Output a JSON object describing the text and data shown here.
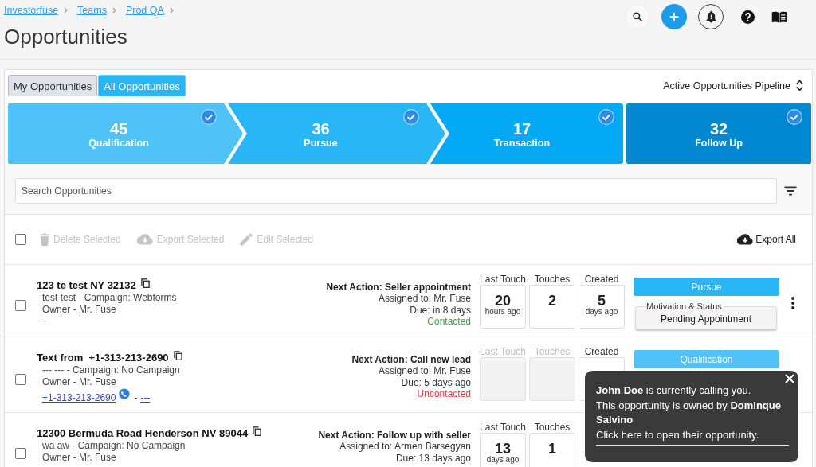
{
  "breadcrumbs": [
    {
      "label": "Investorfuse"
    },
    {
      "label": "Teams"
    },
    {
      "label": "Prod QA"
    }
  ],
  "page_title": "Opportunities",
  "tabs": [
    {
      "label": "My Opportunities",
      "selected": false
    },
    {
      "label": "All Opportunities",
      "selected": true
    }
  ],
  "pipeline_selector": "Active Opportunities Pipeline",
  "stages": [
    {
      "count": "45",
      "label": "Qualification",
      "checked": true,
      "color": "#4fc3f7"
    },
    {
      "count": "36",
      "label": "Pursue",
      "checked": true,
      "color": "#29b6f6"
    },
    {
      "count": "17",
      "label": "Transaction",
      "checked": true,
      "color": "#03a9f4"
    },
    {
      "count": "32",
      "label": "Follow Up",
      "checked": true,
      "color": "#0288d1"
    }
  ],
  "search": {
    "placeholder": "Search Opportunities"
  },
  "bulk_actions": {
    "select_all_checked": false,
    "actions": [
      {
        "kind": "delete",
        "label": "Delete Selected",
        "disabled": true
      },
      {
        "kind": "export",
        "label": "Export Selected",
        "disabled": true
      },
      {
        "kind": "edit",
        "label": "Edit Selected",
        "disabled": true
      }
    ],
    "export_all": "Export All"
  },
  "opportunities": [
    {
      "checked": false,
      "title": "123 te test NY 32132",
      "lines": [
        "test test - Campaign: Webforms",
        "Owner - Mr. Fuse",
        "-"
      ],
      "next_action": "Next Action: Seller appointment",
      "assigned": "Assigned to: Mr. Fuse",
      "due": "Due: in 8 days",
      "contact_status": {
        "label": "Contacted",
        "contacted": true
      },
      "stats": [
        {
          "label": "Last Touch",
          "value": "20",
          "unit": "hours ago",
          "empty": false
        },
        {
          "label": "Touches",
          "value": "2",
          "empty": false
        },
        {
          "label": "Created",
          "value": "5",
          "unit": "days ago",
          "empty": false
        }
      ],
      "stage": {
        "label": "Pursue",
        "color": "#29b6f6"
      },
      "motivation": {
        "legend": "Motivation & Status",
        "value": "Pending Appointment"
      },
      "menu_button": true
    },
    {
      "checked": false,
      "title": "Text from  +1-313-213-2690",
      "lines": [
        "--- --- - Campaign: No Campaign",
        "Owner - Mr. Fuse"
      ],
      "phone": {
        "number": "+1-313-213-2690",
        "separator": "-",
        "name": "---"
      },
      "next_action": "Next Action: Call new lead",
      "assigned": "Assigned to: Mr. Fuse",
      "due": "Due: 5 days ago",
      "contact_status": {
        "label": "Uncontacted",
        "contacted": false
      },
      "stats": [
        {
          "label": "Last Touch",
          "empty": true
        },
        {
          "label": "Touches",
          "empty": true
        },
        {
          "label": "Created",
          "empty": false
        }
      ],
      "stage": {
        "label": "Qualification",
        "color": "#4fc3f7"
      },
      "menu_button": false
    },
    {
      "checked": false,
      "title": "12300 Bermuda Road Henderson NV 89044",
      "lines": [
        "wa aw - Campaign: No Campaign",
        "Owner - Mr. Fuse"
      ],
      "next_action": "Next Action: Follow up with seller",
      "assigned": "Assigned to: Armen Barsegyan",
      "due": "Due: 13 days ago",
      "stats": [
        {
          "label": "Last Touch",
          "value": "13",
          "unit": "days ago",
          "empty": false
        },
        {
          "label": "Touches",
          "value": "1",
          "empty": false
        }
      ],
      "menu_button": false
    }
  ],
  "call_toast": {
    "caller_line": "**John Doe** is currently calling you.",
    "owner_line": "This opportunity is owned by **Dominque Salvino**",
    "link": "Click here to open their opportunity."
  }
}
